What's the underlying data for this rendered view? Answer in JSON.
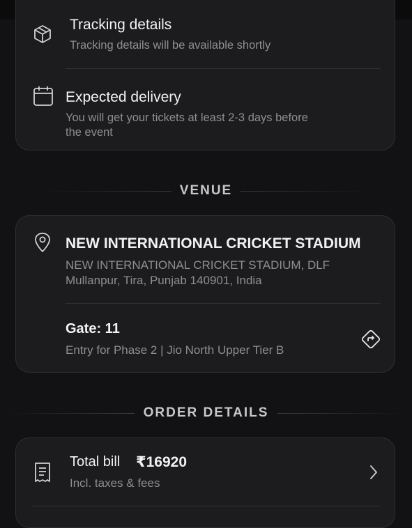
{
  "tracking": {
    "title": "Tracking details",
    "subtitle": "Tracking details will be available shortly",
    "icon": "box-icon"
  },
  "delivery": {
    "title": "Expected delivery",
    "subtitle_line1": "You will get your tickets at least 2-3 days before",
    "subtitle_line2": "the event",
    "icon": "calendar-icon"
  },
  "venue_section": {
    "label": "VENUE"
  },
  "venue": {
    "name": "NEW INTERNATIONAL CRICKET STADIUM",
    "address_line1": "NEW INTERNATIONAL CRICKET STADIUM, DLF",
    "address_line2": "Mullanpur, Tira, Punjab 140901, India",
    "gate": "Gate: 11",
    "entry": "Entry for Phase 2 | Jio North Upper Tier B",
    "icon": "location-pin-icon",
    "directions_icon": "directions-icon"
  },
  "order_section": {
    "label": "ORDER DETAILS"
  },
  "order": {
    "total_label": "Total bill",
    "total_value": "₹16920",
    "subtitle": "Incl. taxes & fees",
    "icon": "receipt-icon",
    "chevron_icon": "chevron-right-icon"
  }
}
